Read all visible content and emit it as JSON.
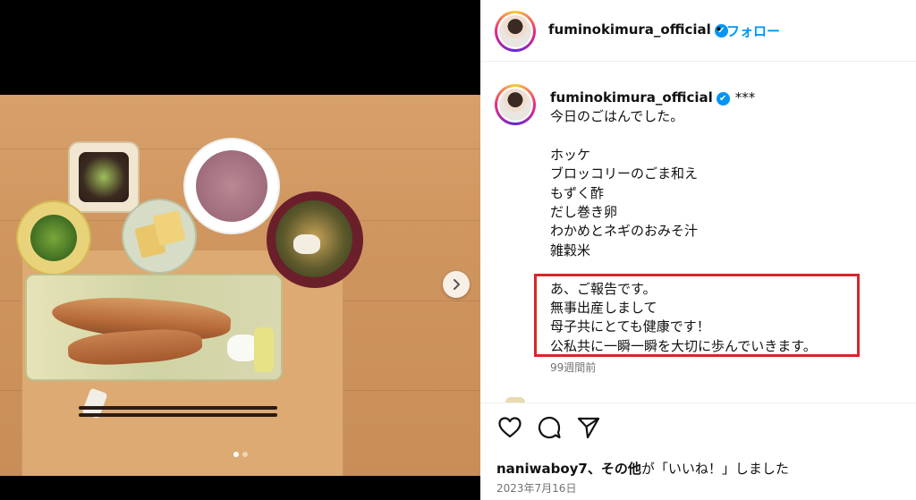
{
  "post": {
    "username": "fuminokimura_official",
    "verified_mark": "✔",
    "bullet": "•",
    "follow_label": "フォロー",
    "media": {
      "carousel_total": 2,
      "carousel_active": 1,
      "next_icon": "chevron-right-icon"
    },
    "caption": {
      "stars": "***",
      "text": "今日のごはんでした。\n\nホッケ\nブロッコリーのごま和え\nもずく酢\nだし巻き卵\nわかめとネギのおみそ汁\n雑穀米\n\nあ、ご報告です。\n無事出産しまして\n母子共にとても健康です！\n公私共に一瞬一瞬を大切に歩んでいきます。",
      "time_ago": "99週間前"
    },
    "actions": {
      "icons": [
        "heart-icon",
        "comment-icon",
        "share-icon"
      ]
    },
    "likes": {
      "user": "naniwaboy7",
      "rest": "、その他",
      "suffix": "が「いいね！」しました"
    },
    "date": "2023年7月16日",
    "colors": {
      "accent": "#0095f6",
      "highlight_box": "#d9252a",
      "muted": "#737373"
    }
  }
}
